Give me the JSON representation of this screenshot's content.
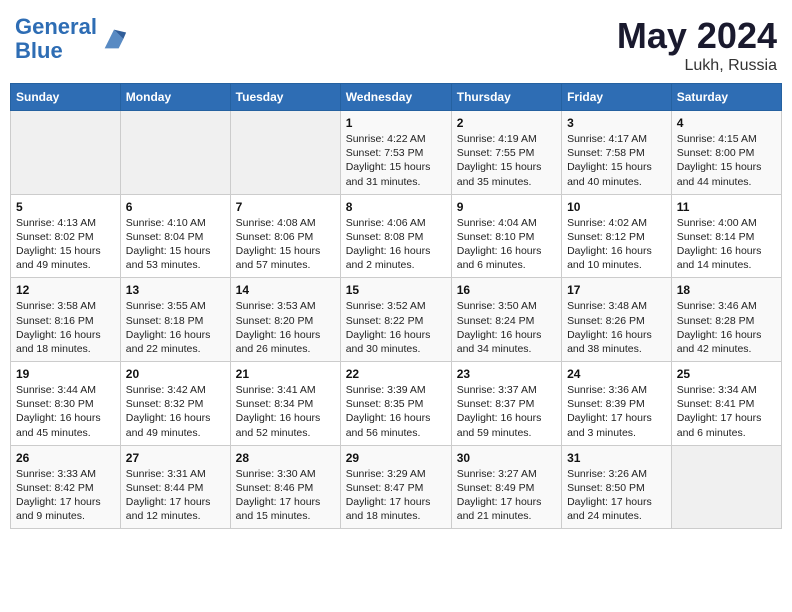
{
  "header": {
    "logo_line1": "General",
    "logo_line2": "Blue",
    "month_year": "May 2024",
    "location": "Lukh, Russia"
  },
  "weekdays": [
    "Sunday",
    "Monday",
    "Tuesday",
    "Wednesday",
    "Thursday",
    "Friday",
    "Saturday"
  ],
  "weeks": [
    [
      {
        "day": "",
        "info": ""
      },
      {
        "day": "",
        "info": ""
      },
      {
        "day": "",
        "info": ""
      },
      {
        "day": "1",
        "info": "Sunrise: 4:22 AM\nSunset: 7:53 PM\nDaylight: 15 hours\nand 31 minutes."
      },
      {
        "day": "2",
        "info": "Sunrise: 4:19 AM\nSunset: 7:55 PM\nDaylight: 15 hours\nand 35 minutes."
      },
      {
        "day": "3",
        "info": "Sunrise: 4:17 AM\nSunset: 7:58 PM\nDaylight: 15 hours\nand 40 minutes."
      },
      {
        "day": "4",
        "info": "Sunrise: 4:15 AM\nSunset: 8:00 PM\nDaylight: 15 hours\nand 44 minutes."
      }
    ],
    [
      {
        "day": "5",
        "info": "Sunrise: 4:13 AM\nSunset: 8:02 PM\nDaylight: 15 hours\nand 49 minutes."
      },
      {
        "day": "6",
        "info": "Sunrise: 4:10 AM\nSunset: 8:04 PM\nDaylight: 15 hours\nand 53 minutes."
      },
      {
        "day": "7",
        "info": "Sunrise: 4:08 AM\nSunset: 8:06 PM\nDaylight: 15 hours\nand 57 minutes."
      },
      {
        "day": "8",
        "info": "Sunrise: 4:06 AM\nSunset: 8:08 PM\nDaylight: 16 hours\nand 2 minutes."
      },
      {
        "day": "9",
        "info": "Sunrise: 4:04 AM\nSunset: 8:10 PM\nDaylight: 16 hours\nand 6 minutes."
      },
      {
        "day": "10",
        "info": "Sunrise: 4:02 AM\nSunset: 8:12 PM\nDaylight: 16 hours\nand 10 minutes."
      },
      {
        "day": "11",
        "info": "Sunrise: 4:00 AM\nSunset: 8:14 PM\nDaylight: 16 hours\nand 14 minutes."
      }
    ],
    [
      {
        "day": "12",
        "info": "Sunrise: 3:58 AM\nSunset: 8:16 PM\nDaylight: 16 hours\nand 18 minutes."
      },
      {
        "day": "13",
        "info": "Sunrise: 3:55 AM\nSunset: 8:18 PM\nDaylight: 16 hours\nand 22 minutes."
      },
      {
        "day": "14",
        "info": "Sunrise: 3:53 AM\nSunset: 8:20 PM\nDaylight: 16 hours\nand 26 minutes."
      },
      {
        "day": "15",
        "info": "Sunrise: 3:52 AM\nSunset: 8:22 PM\nDaylight: 16 hours\nand 30 minutes."
      },
      {
        "day": "16",
        "info": "Sunrise: 3:50 AM\nSunset: 8:24 PM\nDaylight: 16 hours\nand 34 minutes."
      },
      {
        "day": "17",
        "info": "Sunrise: 3:48 AM\nSunset: 8:26 PM\nDaylight: 16 hours\nand 38 minutes."
      },
      {
        "day": "18",
        "info": "Sunrise: 3:46 AM\nSunset: 8:28 PM\nDaylight: 16 hours\nand 42 minutes."
      }
    ],
    [
      {
        "day": "19",
        "info": "Sunrise: 3:44 AM\nSunset: 8:30 PM\nDaylight: 16 hours\nand 45 minutes."
      },
      {
        "day": "20",
        "info": "Sunrise: 3:42 AM\nSunset: 8:32 PM\nDaylight: 16 hours\nand 49 minutes."
      },
      {
        "day": "21",
        "info": "Sunrise: 3:41 AM\nSunset: 8:34 PM\nDaylight: 16 hours\nand 52 minutes."
      },
      {
        "day": "22",
        "info": "Sunrise: 3:39 AM\nSunset: 8:35 PM\nDaylight: 16 hours\nand 56 minutes."
      },
      {
        "day": "23",
        "info": "Sunrise: 3:37 AM\nSunset: 8:37 PM\nDaylight: 16 hours\nand 59 minutes."
      },
      {
        "day": "24",
        "info": "Sunrise: 3:36 AM\nSunset: 8:39 PM\nDaylight: 17 hours\nand 3 minutes."
      },
      {
        "day": "25",
        "info": "Sunrise: 3:34 AM\nSunset: 8:41 PM\nDaylight: 17 hours\nand 6 minutes."
      }
    ],
    [
      {
        "day": "26",
        "info": "Sunrise: 3:33 AM\nSunset: 8:42 PM\nDaylight: 17 hours\nand 9 minutes."
      },
      {
        "day": "27",
        "info": "Sunrise: 3:31 AM\nSunset: 8:44 PM\nDaylight: 17 hours\nand 12 minutes."
      },
      {
        "day": "28",
        "info": "Sunrise: 3:30 AM\nSunset: 8:46 PM\nDaylight: 17 hours\nand 15 minutes."
      },
      {
        "day": "29",
        "info": "Sunrise: 3:29 AM\nSunset: 8:47 PM\nDaylight: 17 hours\nand 18 minutes."
      },
      {
        "day": "30",
        "info": "Sunrise: 3:27 AM\nSunset: 8:49 PM\nDaylight: 17 hours\nand 21 minutes."
      },
      {
        "day": "31",
        "info": "Sunrise: 3:26 AM\nSunset: 8:50 PM\nDaylight: 17 hours\nand 24 minutes."
      },
      {
        "day": "",
        "info": ""
      }
    ]
  ]
}
